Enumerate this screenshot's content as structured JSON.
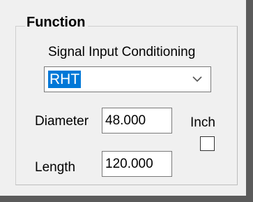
{
  "function_group": {
    "title": "Function",
    "signal_input_label": "Signal Input Conditioning",
    "signal_input_value": "RHT",
    "dropdown_icon": "chevron-down-icon",
    "diameter_label": "Diameter",
    "diameter_value": "48.000",
    "length_label": "Length",
    "length_value": "120.000",
    "inch_label": "Inch",
    "inch_checked": false
  }
}
